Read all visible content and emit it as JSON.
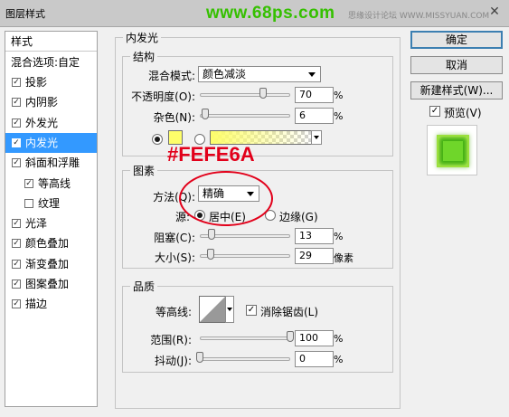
{
  "window": {
    "title": "图层样式",
    "close_glyph": "✕",
    "watermark_site": "www.68ps.com",
    "watermark_forum": "思缘设计论坛  WWW.MISSYUAN.COM"
  },
  "left_panel": {
    "header": "样式",
    "blend_options": "混合选项:自定",
    "items": [
      {
        "label": "投影",
        "checked": true
      },
      {
        "label": "内阴影",
        "checked": true
      },
      {
        "label": "外发光",
        "checked": true
      },
      {
        "label": "内发光",
        "checked": true,
        "selected": true
      },
      {
        "label": "斜面和浮雕",
        "checked": true
      },
      {
        "label": "等高线",
        "checked": true,
        "indent": true
      },
      {
        "label": "纹理",
        "checked": false,
        "indent": true
      },
      {
        "label": "光泽",
        "checked": true
      },
      {
        "label": "颜色叠加",
        "checked": true
      },
      {
        "label": "渐变叠加",
        "checked": true
      },
      {
        "label": "图案叠加",
        "checked": true
      },
      {
        "label": "描边",
        "checked": true
      }
    ]
  },
  "inner_glow": {
    "section_title": "内发光",
    "structure": {
      "title": "结构",
      "blend_mode_label": "混合模式:",
      "blend_mode_value": "颜色减淡",
      "opacity_label": "不透明度(O):",
      "opacity_value": "70",
      "opacity_unit": "%",
      "opacity_fraction": 0.7,
      "noise_label": "杂色(N):",
      "noise_value": "6",
      "noise_unit": "%",
      "noise_fraction": 0.06,
      "color_swatch": "#fefe6a",
      "gradient_color": "#fefe6a"
    },
    "elements": {
      "title": "图素",
      "method_label": "方法(Q):",
      "method_value": "精确",
      "source_label": "源:",
      "source_center": "居中(E)",
      "source_edge": "边缘(G)",
      "choke_label": "阻塞(C):",
      "choke_value": "13",
      "choke_unit": "%",
      "choke_fraction": 0.13,
      "size_label": "大小(S):",
      "size_value": "29",
      "size_unit": "像素",
      "size_fraction": 0.1165
    },
    "quality": {
      "title": "品质",
      "contour_label": "等高线:",
      "antialias_label": "消除锯齿(L)",
      "antialias_checked": true,
      "range_label": "范围(R):",
      "range_value": "100",
      "range_unit": "%",
      "range_fraction": 1.0,
      "jitter_label": "抖动(J):",
      "jitter_value": "0",
      "jitter_unit": "%",
      "jitter_fraction": 0.0
    }
  },
  "buttons": {
    "ok": "确定",
    "cancel": "取消",
    "new_style": "新建样式(W)...",
    "preview": "预览(V)",
    "preview_checked": true
  },
  "annotation": {
    "hex_text": "#FEFE6A",
    "color": "#e2001a"
  },
  "colors": {
    "selection": "#3399ff",
    "preview_green": "#5cc817"
  }
}
